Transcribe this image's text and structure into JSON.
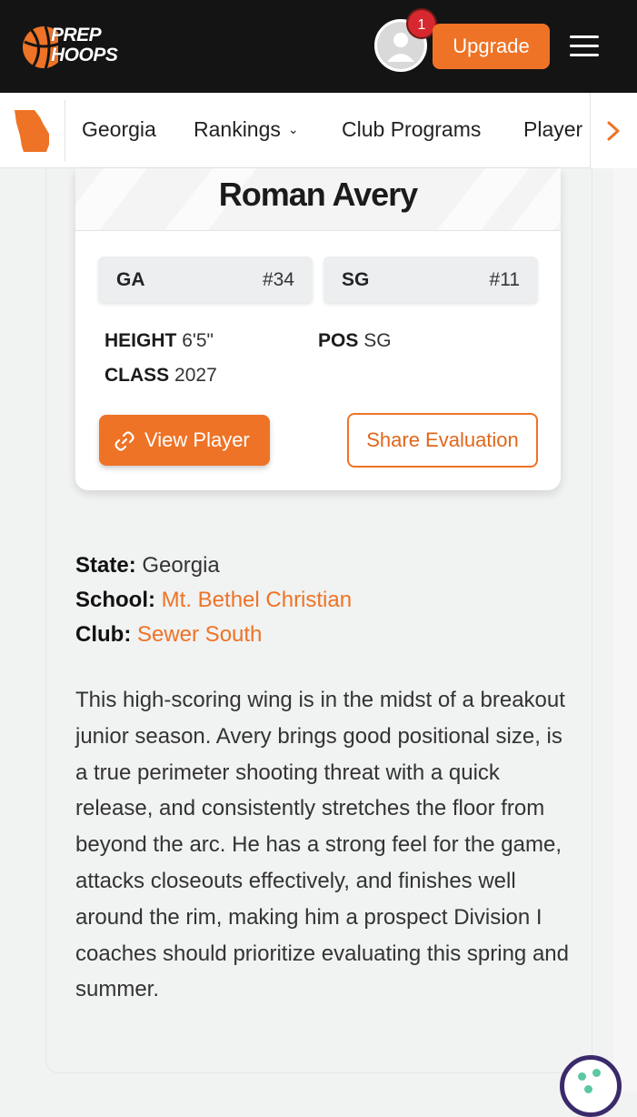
{
  "header": {
    "logo_line1": "PREP",
    "logo_line2": "HOOPS",
    "notification_count": "1",
    "upgrade_label": "Upgrade"
  },
  "nav": {
    "items": [
      "Georgia",
      "Rankings",
      "Club Programs",
      "Player"
    ]
  },
  "player": {
    "name": "Roman Avery",
    "state_rank": {
      "label": "GA",
      "rank": "#34"
    },
    "position_rank": {
      "label": "SG",
      "rank": "#11"
    },
    "height_label": "HEIGHT",
    "height_value": "6'5\"",
    "pos_label": "POS",
    "pos_value": "SG",
    "class_label": "CLASS",
    "class_value": "2027",
    "view_button": "View Player",
    "share_button": "Share Evaluation"
  },
  "details": {
    "state_label": "State:",
    "state_value": "Georgia",
    "school_label": "School:",
    "school_value": "Mt. Bethel Christian",
    "club_label": "Club:",
    "club_value": "Sewer South"
  },
  "bio": "This high-scoring wing is in the midst of a breakout junior season. Avery brings good positional size, is a true perimeter shooting threat with a quick release, and consistently stretches the floor from beyond the arc. He has a strong feel for the game, attacks closeouts effectively, and finishes well around the rim, making him a prospect Division I coaches should prioritize evaluating this spring and summer.",
  "colors": {
    "accent": "#ee7326",
    "topbar": "#141414",
    "badge": "#d6282e"
  }
}
